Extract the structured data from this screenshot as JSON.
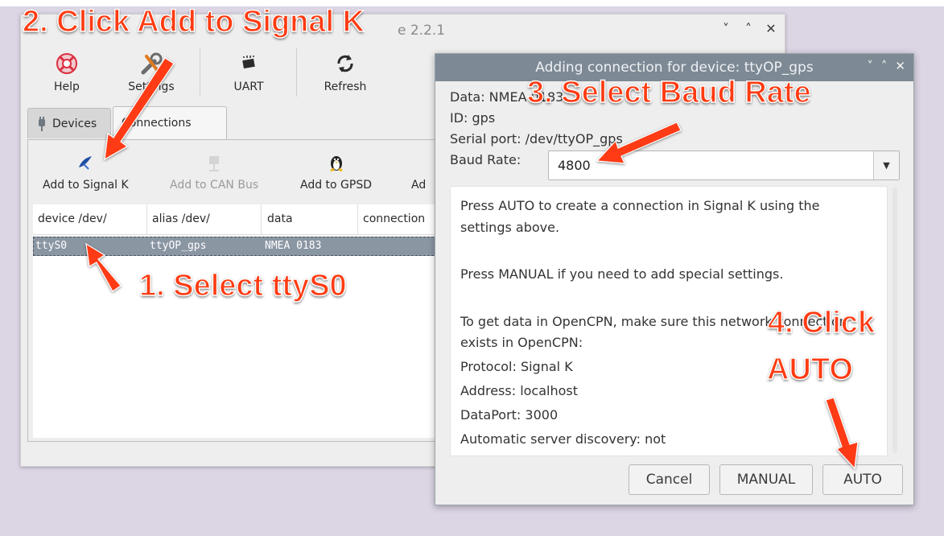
{
  "main_window": {
    "title_fragment": "e 2.2.1",
    "window_controls": [
      "˅",
      "˄",
      "✕"
    ],
    "toolbar": {
      "help": "Help",
      "settings": "Settings",
      "uart": "UART",
      "refresh": "Refresh"
    },
    "tabs": {
      "devices": "Devices",
      "connections": "Connections"
    },
    "actions": {
      "add_signal_k": "Add to Signal K",
      "add_can_bus": "Add to CAN Bus",
      "add_gpsd": "Add to GPSD",
      "add_more_partial": "Ad"
    },
    "table": {
      "columns": [
        "device /dev/",
        "alias /dev/",
        "data",
        "connection"
      ],
      "rows": [
        {
          "device": "ttyS0",
          "alias": "ttyOP_gps",
          "data": "NMEA 0183",
          "connection": ""
        }
      ]
    }
  },
  "dialog": {
    "title": "Adding connection for device: ttyOP_gps",
    "window_controls": [
      "˅",
      "˄",
      "✕"
    ],
    "info": {
      "data": "Data: NMEA 0183",
      "id": "ID: gps",
      "serial_port": "Serial port: /dev/ttyOP_gps",
      "baud_label": "Baud Rate:"
    },
    "baud_rate_value": "4800",
    "message_lines": [
      "Press AUTO to create a connection in Signal K using the",
      "settings above.",
      "",
      "Press MANUAL if you need to add special settings.",
      "",
      "To get data in OpenCPN, make sure this network connection",
      "exists in OpenCPN:",
      "Protocol: Signal K",
      "Address: localhost",
      "DataPort: 3000",
      "Automatic server discovery: not"
    ],
    "buttons": {
      "cancel": "Cancel",
      "manual": "MANUAL",
      "auto": "AUTO"
    }
  },
  "annotations": {
    "step1": "1. Select ttyS0",
    "step2": "2. Click Add to Signal K",
    "step3": "3. Select Baud Rate",
    "step4_line1": "4. Click",
    "step4_line2": "AUTO"
  },
  "colors": {
    "annotation_red": "#ff3b12",
    "dialog_titlebar": "#7d8994",
    "selected_row": "#8b96a3"
  }
}
